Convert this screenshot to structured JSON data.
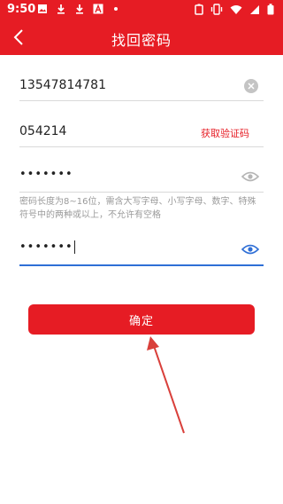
{
  "status_bar": {
    "time": "9:50",
    "icons": [
      "image-icon",
      "download-icon",
      "download-icon",
      "text-a-icon",
      "dot-icon",
      "battery-icon",
      "vibrate-icon",
      "wifi-icon",
      "signal-icon",
      "battery-full-icon"
    ]
  },
  "header": {
    "title": "找回密码",
    "back_icon": "chevron-left-icon"
  },
  "form": {
    "phone_value": "13547814781",
    "code_value": "054214",
    "get_code_label": "获取验证码",
    "password_value": "•••••••",
    "password_hint": "密码长度为8~16位，需含大写字母、小写字母、数字、特殊符号中的两种或以上，不允许有空格",
    "confirm_password_value": "•••••••"
  },
  "confirm_button_label": "确定",
  "colors": {
    "brand_red": "#e61c24",
    "focus_blue": "#2f6fd6",
    "annotation_arrow": "#d9403b"
  }
}
